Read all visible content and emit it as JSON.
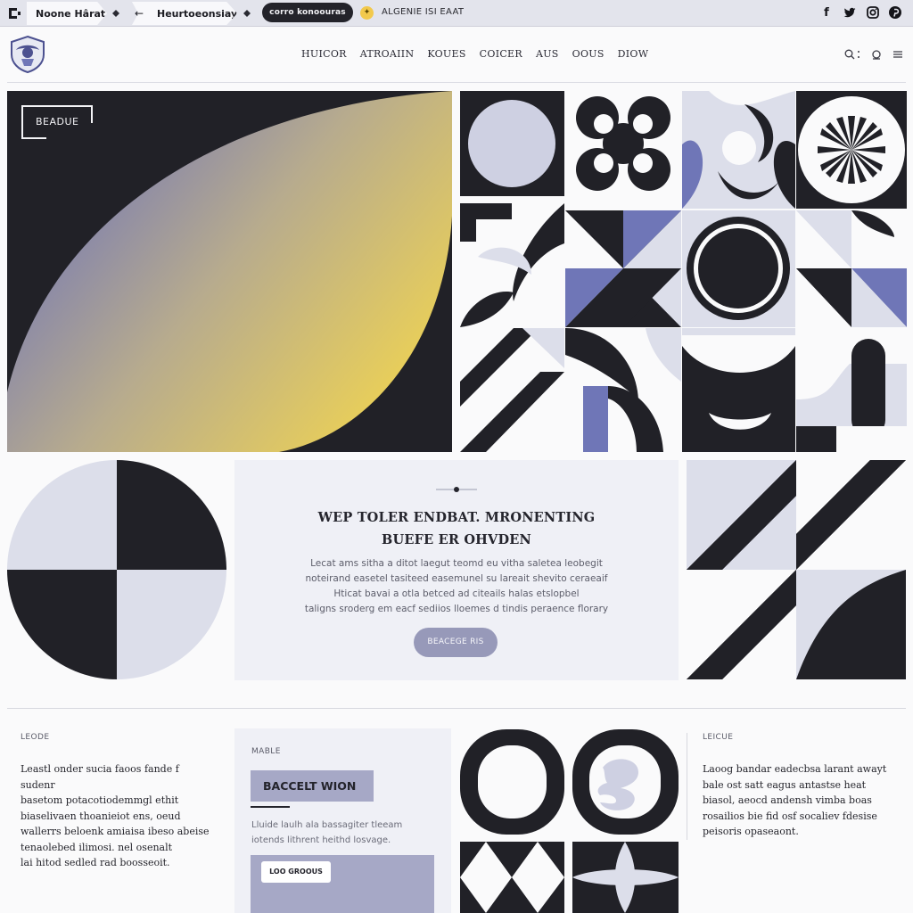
{
  "browser": {
    "tab_active": "Noone Hârat",
    "tab_back": "Heurtoeonsiay",
    "url": "corro konoouras",
    "announcement": "ALGENIE ISI EAAT",
    "social_icons": [
      "facebook-icon",
      "twitter-icon",
      "instagram-icon",
      "pinterest-icon"
    ]
  },
  "header": {
    "nav": [
      "HUICOR",
      "ATROAIIN",
      "KOUES",
      "COICER",
      "AUS",
      "OOUS",
      "DIOW"
    ],
    "icons": [
      "search-icon",
      "menu-dots-icon",
      "user-icon",
      "hamburger-icon"
    ]
  },
  "hero": {
    "label": "BEADUE"
  },
  "feature": {
    "title_line1": "WEP TOLER ENDBAT. MRONENTING",
    "title_line2": "BUEFE ER OHVDEN",
    "body": [
      "Lecat ams sitha a ditot laegut teomd eu vitha saletea leobegit",
      "noteirand easetel tasiteed easemunel su lareait shevito ceraeaif",
      "Hticat bavai a otla betced ad citeails halas etslopbel",
      "taligns sroderg em eacf sediios lloemes d tindis peraence florary"
    ],
    "button": "BEACEGE RIS"
  },
  "bottom_left": {
    "label": "LEODE",
    "text": [
      "Leastl onder sucia faoos fande f sudenr",
      "basetom potacotiodemmgl ethit",
      "biaselivaen thoanieiot ens, oeud",
      "wallerrs beloenk amiaisa ibeso abeise",
      "tenaolebed ilimosi. nel osenalt",
      "lai hitod sedled rad boosseoit."
    ]
  },
  "bottom_card": {
    "label": "MABLE",
    "chip": "BACCELT WION",
    "text": [
      "Lluide laulh ala bassagiter tleeam",
      "iotends lithrent heithd losvage."
    ],
    "button": "LOO GROOUS"
  },
  "bottom_right": {
    "label": "LEICUE",
    "text": [
      "Laoog bandar eadecbsa larant awayt",
      "bale ost satt eagus antastse heat",
      "biasol, aeocd andensh vimba boas",
      "rosailios bie fid osf socaliev fdesise",
      "peisoris opaseaont."
    ]
  },
  "colors": {
    "ink": "#212127",
    "lavender": "#dcdeea",
    "periwinkle": "#6f76b7",
    "accent_yellow": "#f5d84a",
    "button": "#9799b9"
  }
}
